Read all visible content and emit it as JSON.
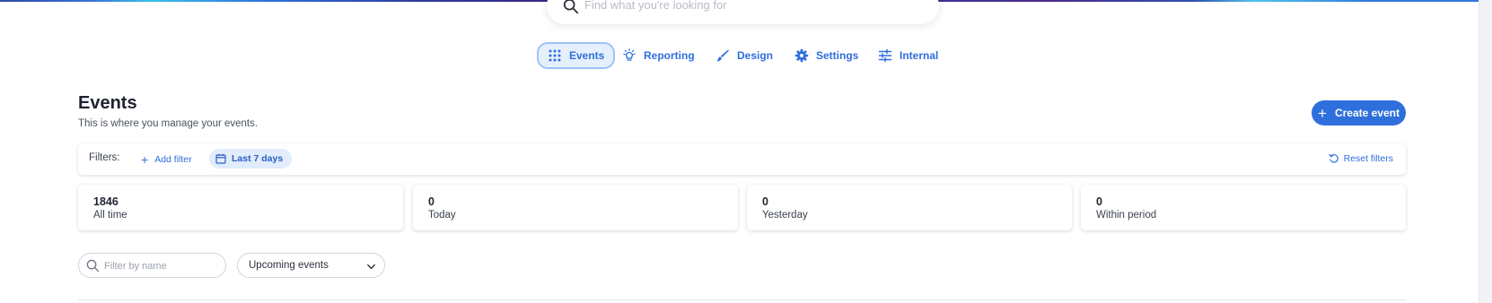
{
  "search": {
    "placeholder": "Find what you're looking for"
  },
  "nav": {
    "items": [
      {
        "label": "Events",
        "icon": "grid-icon",
        "active": true
      },
      {
        "label": "Reporting",
        "icon": "lightbulb-icon"
      },
      {
        "label": "Design",
        "icon": "brush-icon"
      },
      {
        "label": "Settings",
        "icon": "gear-icon"
      },
      {
        "label": "Internal",
        "icon": "sliders-icon"
      }
    ]
  },
  "header": {
    "title": "Events",
    "subtitle": "This is where you manage your events.",
    "create_label": "Create event"
  },
  "filters": {
    "label": "Filters:",
    "add_label": "Add filter",
    "active_chip": "Last 7 days",
    "reset_label": "Reset filters"
  },
  "stats": [
    {
      "value": "1846",
      "caption": "All time"
    },
    {
      "value": "0",
      "caption": "Today"
    },
    {
      "value": "0",
      "caption": "Yesterday"
    },
    {
      "value": "0",
      "caption": "Within period"
    }
  ],
  "list_controls": {
    "name_placeholder": "Filter by name",
    "name_value": "",
    "period_value": "Upcoming events"
  },
  "colors": {
    "accent": "#2f6fdc",
    "chip_bg": "#e1ecfc",
    "active_tab_border": "#9ec3f5"
  }
}
